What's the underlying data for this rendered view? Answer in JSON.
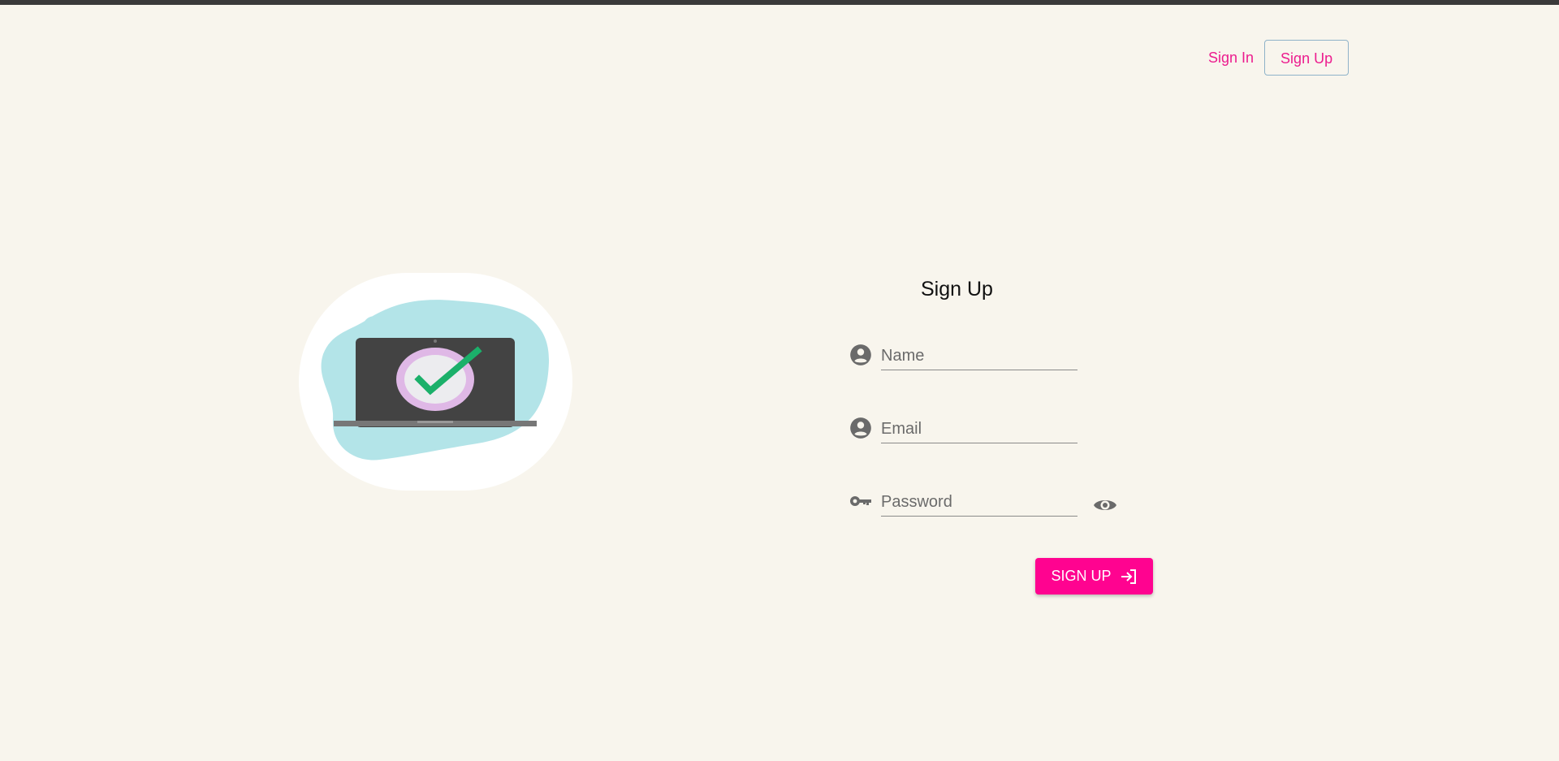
{
  "nav": {
    "sign_in": "Sign In",
    "sign_up": "Sign Up"
  },
  "form": {
    "title": "Sign Up",
    "name_placeholder": "Name",
    "email_placeholder": "Email",
    "password_placeholder": "Password",
    "submit_label": "SIGN UP"
  },
  "icons": {
    "name": "account-circle-icon",
    "email": "account-circle-icon",
    "password": "key-icon",
    "visibility": "eye-icon",
    "submit": "login-icon"
  },
  "colors": {
    "accent": "#ff0390",
    "link": "#ec1c8e",
    "background": "#f8f5ed"
  }
}
